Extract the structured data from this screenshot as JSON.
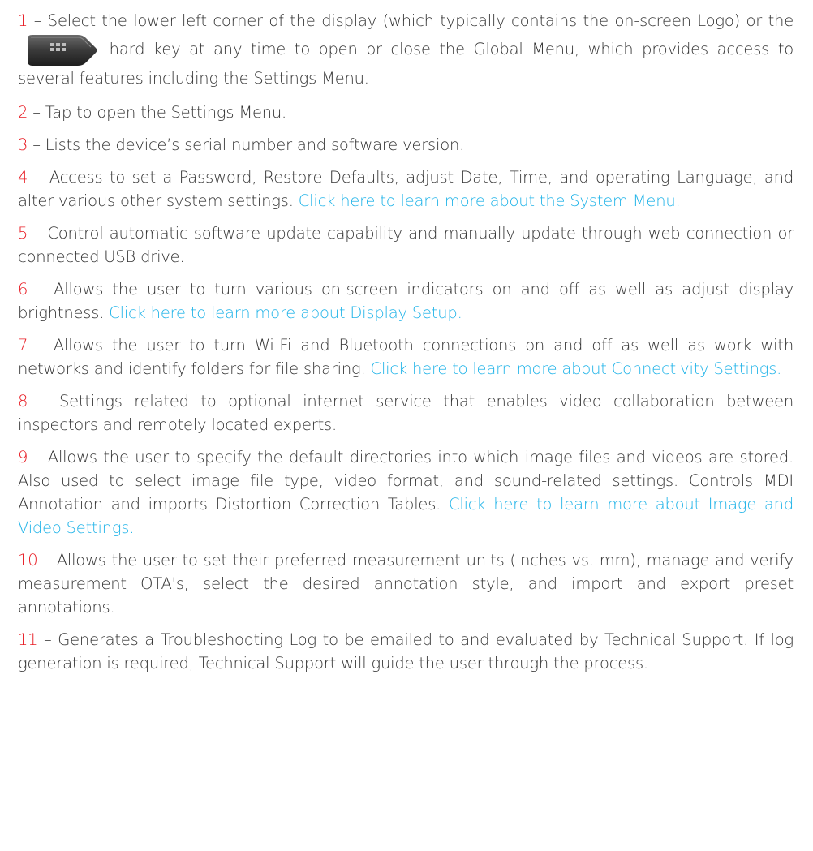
{
  "items": [
    {
      "num": "1",
      "pre": " – Select the lower left corner of the display (which typically contains the on-screen  Logo) or the ",
      "icon": "grid-hard-key-icon",
      "post": " hard key at any time to open or close the Global Menu, which provides access to several features including the Settings Menu."
    },
    {
      "num": "2",
      "text": " – Tap to open the Settings Menu."
    },
    {
      "num": "3",
      "text": " – Lists the device’s serial number and software version."
    },
    {
      "num": "4",
      "text": " – Access to set a Password, Restore Defaults, adjust Date, Time, and operating Language, and alter various other system settings. ",
      "link": "Click here to learn more about the System Menu."
    },
    {
      "num": "5",
      "text": " – Control automatic software update capability and manually update through web connection or connected USB drive."
    },
    {
      "num": "6",
      "text": " – Allows the user to turn various on-screen indicators on and off as well as adjust display brightness. ",
      "link": "Click here to learn more about Display Setup."
    },
    {
      "num": "7",
      "text": " – Allows the user to turn Wi-Fi and Bluetooth connections on and off as well as work with networks and identify folders for file sharing. ",
      "link": "Click here to learn more about Connectivity Settings."
    },
    {
      "num": "8",
      "text": " – Settings related to optional internet service that enables video collaboration between inspectors and remotely located experts."
    },
    {
      "num": "9",
      "text": " – Allows the user to specify the default directories into which image files and videos are stored. Also used to select image file type, video format, and sound-related settings. Controls MDI Annotation and imports Distortion Correction Tables. ",
      "link": "Click here to learn more about Image and Video Settings."
    },
    {
      "num": "10",
      "text": " – Allows the user to set their preferred measurement units (inches vs. mm), manage and verify measurement OTA's, select the desired annotation style, and import and export preset annotations."
    },
    {
      "num": "11",
      "text": " – Generates a Troubleshooting Log to be emailed to and evaluated by Technical Support. If log generation is required, Technical Support will guide the user through the process."
    }
  ],
  "colors": {
    "number": "#e81c24",
    "link": "#1fb3e8",
    "text": "#333333"
  }
}
